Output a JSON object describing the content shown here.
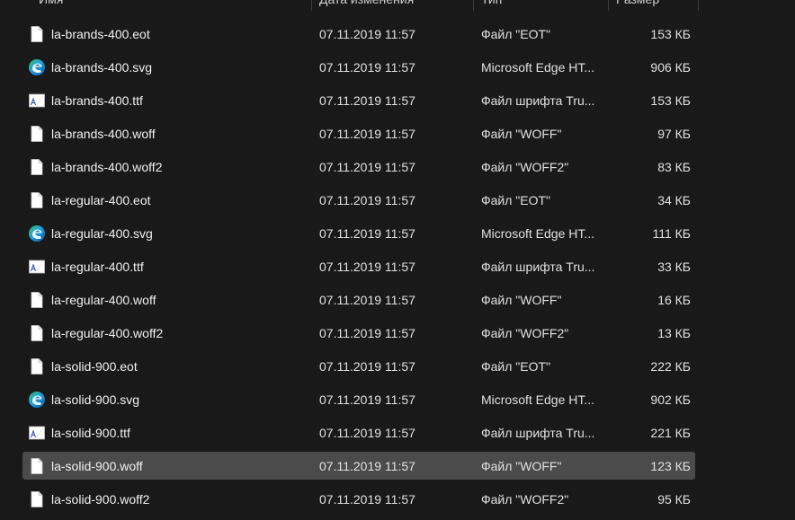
{
  "columns": {
    "name": "Имя",
    "date": "Дата изменения",
    "type": "Тип",
    "size": "Размер"
  },
  "files": [
    {
      "name": "la-brands-400.eot",
      "date": "07.11.2019 11:57",
      "type": "Файл \"EOT\"",
      "size": "153 КБ",
      "icon": "generic-file-icon"
    },
    {
      "name": "la-brands-400.svg",
      "date": "07.11.2019 11:57",
      "type": "Microsoft Edge HT...",
      "size": "906 КБ",
      "icon": "edge-icon"
    },
    {
      "name": "la-brands-400.ttf",
      "date": "07.11.2019 11:57",
      "type": "Файл шрифта Tru...",
      "size": "153 КБ",
      "icon": "font-file-icon"
    },
    {
      "name": "la-brands-400.woff",
      "date": "07.11.2019 11:57",
      "type": "Файл \"WOFF\"",
      "size": "97 КБ",
      "icon": "generic-file-icon"
    },
    {
      "name": "la-brands-400.woff2",
      "date": "07.11.2019 11:57",
      "type": "Файл \"WOFF2\"",
      "size": "83 КБ",
      "icon": "generic-file-icon"
    },
    {
      "name": "la-regular-400.eot",
      "date": "07.11.2019 11:57",
      "type": "Файл \"EOT\"",
      "size": "34 КБ",
      "icon": "generic-file-icon"
    },
    {
      "name": "la-regular-400.svg",
      "date": "07.11.2019 11:57",
      "type": "Microsoft Edge HT...",
      "size": "111 КБ",
      "icon": "edge-icon"
    },
    {
      "name": "la-regular-400.ttf",
      "date": "07.11.2019 11:57",
      "type": "Файл шрифта Tru...",
      "size": "33 КБ",
      "icon": "font-file-icon"
    },
    {
      "name": "la-regular-400.woff",
      "date": "07.11.2019 11:57",
      "type": "Файл \"WOFF\"",
      "size": "16 КБ",
      "icon": "generic-file-icon"
    },
    {
      "name": "la-regular-400.woff2",
      "date": "07.11.2019 11:57",
      "type": "Файл \"WOFF2\"",
      "size": "13 КБ",
      "icon": "generic-file-icon"
    },
    {
      "name": "la-solid-900.eot",
      "date": "07.11.2019 11:57",
      "type": "Файл \"EOT\"",
      "size": "222 КБ",
      "icon": "generic-file-icon"
    },
    {
      "name": "la-solid-900.svg",
      "date": "07.11.2019 11:57",
      "type": "Microsoft Edge HT...",
      "size": "902 КБ",
      "icon": "edge-icon"
    },
    {
      "name": "la-solid-900.ttf",
      "date": "07.11.2019 11:57",
      "type": "Файл шрифта Tru...",
      "size": "221 КБ",
      "icon": "font-file-icon"
    },
    {
      "name": "la-solid-900.woff",
      "date": "07.11.2019 11:57",
      "type": "Файл \"WOFF\"",
      "size": "123 КБ",
      "icon": "generic-file-icon",
      "selected": true
    },
    {
      "name": "la-solid-900.woff2",
      "date": "07.11.2019 11:57",
      "type": "Файл \"WOFF2\"",
      "size": "95 КБ",
      "icon": "generic-file-icon"
    }
  ],
  "colors": {
    "background": "#191919",
    "selection": "#4b4b4b",
    "text": "#e0e0e0",
    "edge_blue": "#1e8ad6",
    "edge_green": "#4cc35b"
  }
}
